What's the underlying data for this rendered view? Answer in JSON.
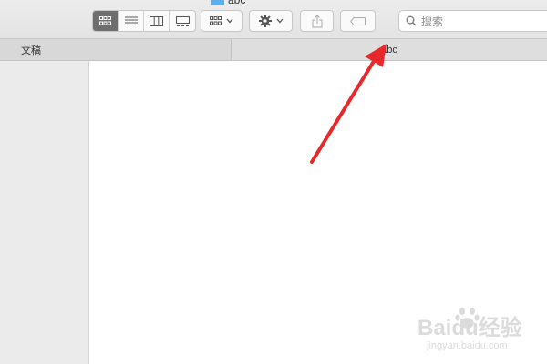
{
  "window": {
    "title": "abc",
    "folder_icon": "folder-icon",
    "folder_color": "#5ab0e8"
  },
  "toolbar": {
    "view_modes": [
      {
        "name": "icon-view",
        "icon": "grid-icon",
        "active": true
      },
      {
        "name": "list-view",
        "icon": "list-icon",
        "active": false
      },
      {
        "name": "column-view",
        "icon": "columns-icon",
        "active": false
      },
      {
        "name": "gallery-view",
        "icon": "gallery-icon",
        "active": false
      }
    ],
    "arrange_icon": "grid-icon",
    "action_icon": "gear-icon",
    "share_icon": "share-icon",
    "tag_icon": "tag-icon",
    "search": {
      "placeholder": "搜索",
      "icon": "search-icon"
    }
  },
  "pathbar": {
    "left_label": "文稿",
    "right_label": "abc"
  },
  "annotation": {
    "type": "arrow",
    "color": "#e8292b"
  },
  "watermark": {
    "brand": "Baidu经验",
    "url": "jingyan.baidu.com"
  }
}
